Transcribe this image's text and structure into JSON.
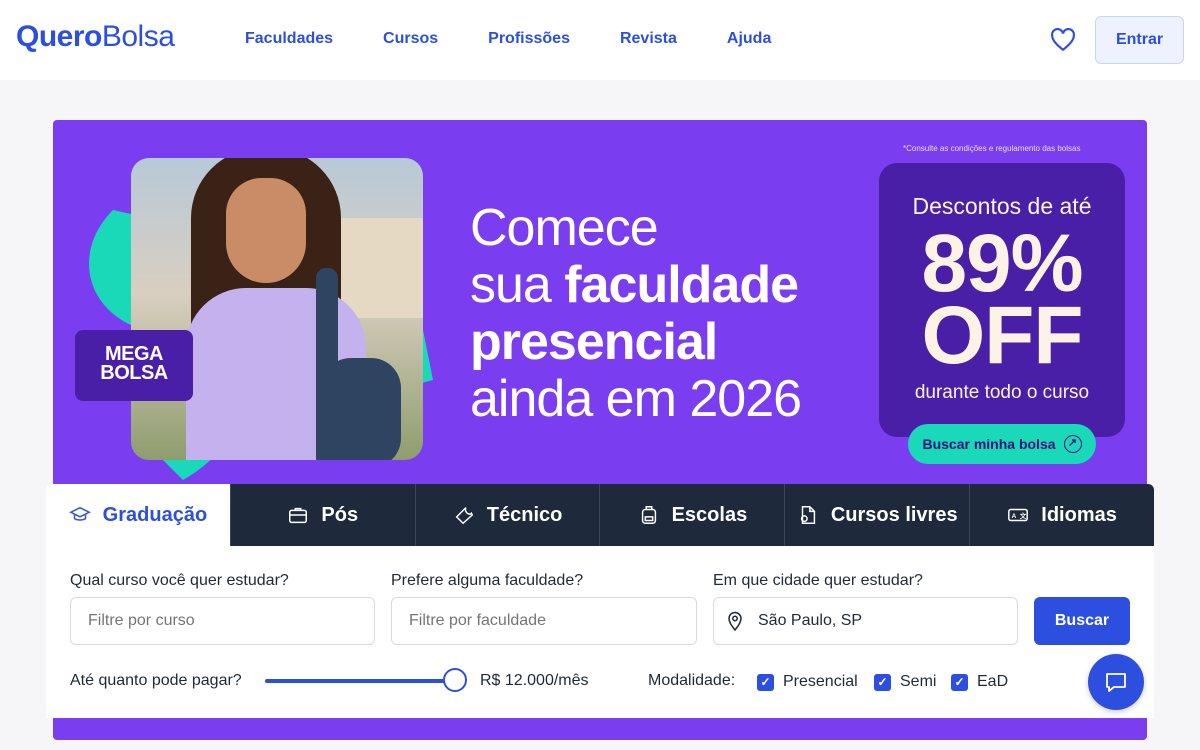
{
  "header": {
    "logo_bold": "Quero",
    "logo_light": "Bolsa",
    "nav": [
      "Faculdades",
      "Cursos",
      "Profissões",
      "Revista",
      "Ajuda"
    ],
    "login_label": "Entrar"
  },
  "hero": {
    "badge_line1": "MEGA",
    "badge_line2": "BOLSA",
    "headline_line1": "Comece",
    "headline_line2_prefix": "sua ",
    "headline_line2_bold": "faculdade",
    "headline_line3_bold": "presencial",
    "headline_line4": "ainda em 2026",
    "disclaimer": "*Consulte as condições e regulamento das bolsas",
    "offer_line1": "Descontos de até",
    "offer_percent": "89%",
    "offer_off": "OFF",
    "offer_line4": "durante todo o curso",
    "cta_label": "Buscar minha bolsa",
    "colors": {
      "background": "#7b3df0",
      "accent": "#19d9b9",
      "card": "#4a1fa8"
    }
  },
  "tabs": [
    {
      "label": "Graduação",
      "icon": "graduation-cap-icon",
      "active": true
    },
    {
      "label": "Pós",
      "icon": "briefcase-icon",
      "active": false
    },
    {
      "label": "Técnico",
      "icon": "wrench-icon",
      "active": false
    },
    {
      "label": "Escolas",
      "icon": "backpack-icon",
      "active": false
    },
    {
      "label": "Cursos livres",
      "icon": "document-icon",
      "active": false
    },
    {
      "label": "Idiomas",
      "icon": "translate-icon",
      "active": false
    }
  ],
  "search": {
    "course_label": "Qual curso você quer estudar?",
    "course_placeholder": "Filtre por curso",
    "college_label": "Prefere alguma faculdade?",
    "college_placeholder": "Filtre por faculdade",
    "city_label": "Em que cidade quer estudar?",
    "city_value": "São Paulo, SP",
    "search_button": "Buscar",
    "pay_label": "Até quanto pode pagar?",
    "pay_value": "R$ 12.000/mês",
    "pay_slider_fraction": 1.0,
    "modality_label": "Modalidade:",
    "modalities": [
      {
        "label": "Presencial",
        "checked": true
      },
      {
        "label": "Semi",
        "checked": true
      },
      {
        "label": "EaD",
        "checked": true
      }
    ]
  },
  "brand_color": "#2d4fe0"
}
